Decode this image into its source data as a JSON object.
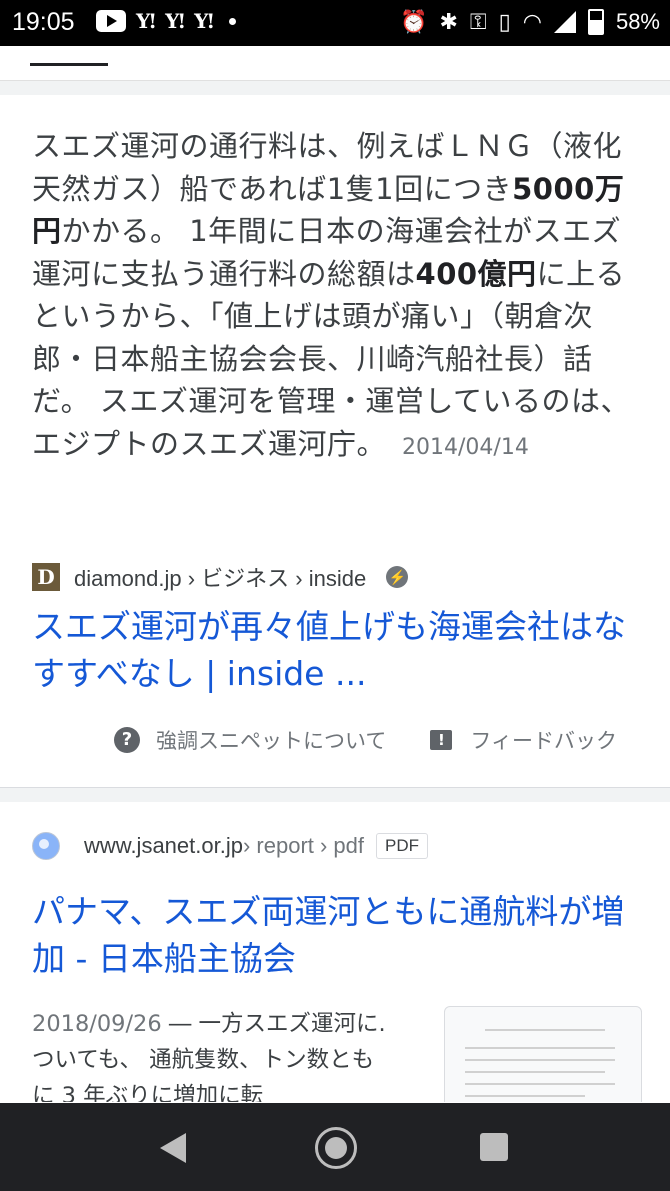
{
  "status_bar": {
    "time": "19:05",
    "yahoo_label": "Y!",
    "battery_percent": "58%"
  },
  "result1": {
    "snippet_parts": [
      {
        "text": "スエズ運河の通行料は、例えばＬＮＧ（液化天然ガス）船であれば1隻1回につき",
        "bold": false
      },
      {
        "text": "5000万円",
        "bold": true
      },
      {
        "text": "かかる。 1年間に日本の海運会社がスエズ運河に支払う通行料の総額は",
        "bold": false
      },
      {
        "text": "400億円",
        "bold": true
      },
      {
        "text": "に上るというから、「値上げは頭が痛い」（朝倉次郎・日本船主協会会長、川崎汽船社長）話だ。 スエズ運河を管理・運営しているのは、エジプトのスエズ運河庁。",
        "bold": false
      }
    ],
    "date": "2014/04/14",
    "source_favicon": "D",
    "source_path": "diamond.jp › ビジネス › inside",
    "title": "スエズ運河が再々値上げも海運会社はなすすべなし | inside ...",
    "footer": {
      "about_label": "強調スニペットについて",
      "feedback_label": "フィードバック"
    }
  },
  "result2": {
    "source_domain": "www.jsanet.or.jp",
    "source_path": " › report › pdf",
    "badge": "PDF",
    "title": "パナマ、スエズ両運河ともに通航料が増加 - 日本船主協会",
    "date": "2018/09/26",
    "snippet": " ― 一方スエズ運河に. ついても、 通航隻数、トン数ともに 3 年ぶりに増加に転"
  },
  "colors": {
    "link": "#1558d6",
    "text": "#3c4043",
    "meta": "#70757a",
    "nav_bg": "#202124"
  }
}
